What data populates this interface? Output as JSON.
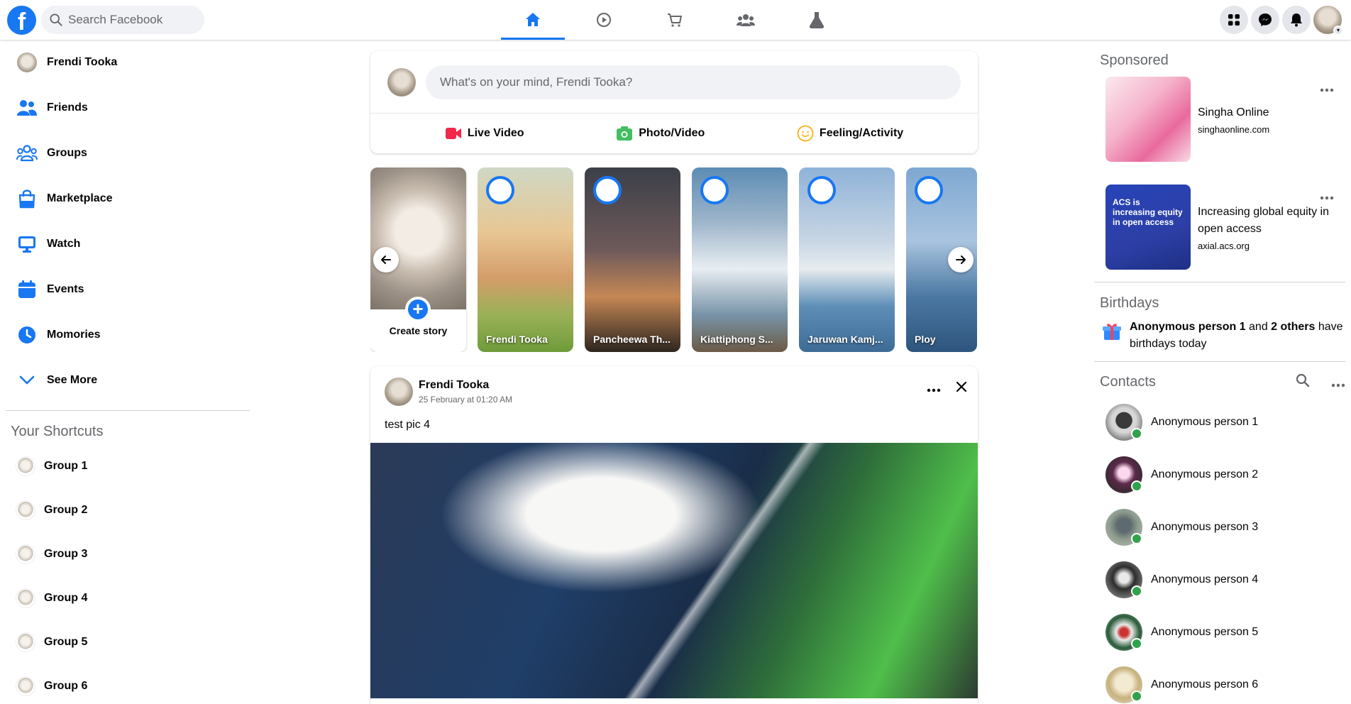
{
  "colors": {
    "brand": "#1877f2",
    "online": "#31a24c",
    "bg_gray": "#f0f2f5",
    "text_muted": "#65676b"
  },
  "logo_text": "f",
  "search": {
    "placeholder": "Search Facebook"
  },
  "nav_tabs": [
    "home-icon",
    "watch-icon",
    "marketplace-icon",
    "groups-icon",
    "gaming-icon"
  ],
  "left": {
    "profile_name": "Frendi Tooka",
    "items": [
      {
        "label": "Friends",
        "icon": "friends-icon"
      },
      {
        "label": "Groups",
        "icon": "groups-icon"
      },
      {
        "label": "Marketplace",
        "icon": "marketplace-icon"
      },
      {
        "label": "Watch",
        "icon": "watch-icon"
      },
      {
        "label": "Events",
        "icon": "events-icon"
      },
      {
        "label": "Momories",
        "icon": "memories-icon"
      },
      {
        "label": "See More",
        "icon": "chevron-down-icon"
      }
    ],
    "shortcuts_title": "Your Shortcuts",
    "shortcuts": [
      "Group 1",
      "Group 2",
      "Group 3",
      "Group 4",
      "Group 5",
      "Group 6"
    ]
  },
  "composer": {
    "placeholder": "What's on your mind, Frendi Tooka?",
    "actions": [
      "Live Video",
      "Photo/Video",
      "Feeling/Activity"
    ]
  },
  "stories": {
    "create_label": "Create story",
    "items": [
      "Frendi Tooka",
      "Pancheewa Th...",
      "Kiattiphong S...",
      "Jaruwan Kamj...",
      "Ploy"
    ]
  },
  "post": {
    "author": "Frendi Tooka",
    "date": "25 February at 01:20 AM",
    "text": "test pic 4"
  },
  "right": {
    "sponsored_title": "Sponsored",
    "ads": [
      {
        "name": "Singha Online",
        "domain": "singhaonline.com"
      },
      {
        "name": "Increasing global equity in open access",
        "domain": "axial.acs.org",
        "thumb_text": "ACS is increasing equity in open access"
      }
    ],
    "birthdays_title": "Birthdays",
    "birthday_lead": "Anonymous person 1",
    "birthday_and": " and ",
    "birthday_others": "2 others",
    "birthday_tail": " have birthdays today",
    "contacts_title": "Contacts",
    "contacts": [
      "Anonymous person 1",
      "Anonymous person 2",
      "Anonymous person 3",
      "Anonymous person 4",
      "Anonymous person 5",
      "Anonymous person 6"
    ]
  }
}
